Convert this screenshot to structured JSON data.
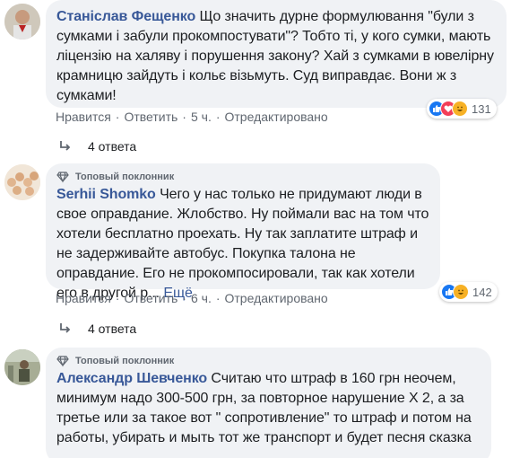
{
  "comments": [
    {
      "author": "Станіслав Фещенко",
      "badge": "",
      "text": "Що значить дурне формулювання \"були з сумками і забули прокомпостувати\"? Тобто ті, у кого сумки, мають ліцензію на халяву і порушення закону? Хай з сумками в ювелірну крамницю зайдуть і кольє візьмуть. Суд виправдає. Вони ж з сумками!",
      "actions": {
        "like": "Нравится",
        "reply": "Ответить",
        "time": "5 ч.",
        "edited": "Отредактировано"
      },
      "reactions": {
        "types": [
          "like-icon",
          "love-icon",
          "haha-icon"
        ],
        "count": "131"
      },
      "replies_label": "4 ответа"
    },
    {
      "author": "Serhii Shomko",
      "badge": "Топовый поклонник",
      "text": "Чего у нас только не придумают люди в свое оправдание. Жлобство. Ну поймали вас на том что хотели бесплатно проехать. Ну так заплатите штраф и не задерживайте автобус. Покупка талона не оправдание. Его не прокомпосировали, так как хотели его в другой р...",
      "more": "Ещё",
      "actions": {
        "like": "Нравится",
        "reply": "Ответить",
        "time": "6 ч.",
        "edited": "Отредактировано"
      },
      "reactions": {
        "types": [
          "like-icon",
          "haha-icon"
        ],
        "count": "142"
      },
      "replies_label": "4 ответа"
    },
    {
      "author": "Александр Шевченко",
      "badge": "Топовый поклонник",
      "text": "Считаю что штраф в 160 грн неочем, минимум надо 300-500 грн, за повторное нарушение Х 2, а за третье или за такое вот \" сопротивление\" то штраф и потом на работы, убирать и мыть тот же транспорт и будет песня сказка"
    }
  ],
  "separator": "·",
  "colors": {
    "author": "#385898",
    "bubble": "#f0f2f5",
    "meta": "#606770",
    "like": "#1877f2",
    "love": "#f33e58",
    "haha": "#f7b125"
  }
}
